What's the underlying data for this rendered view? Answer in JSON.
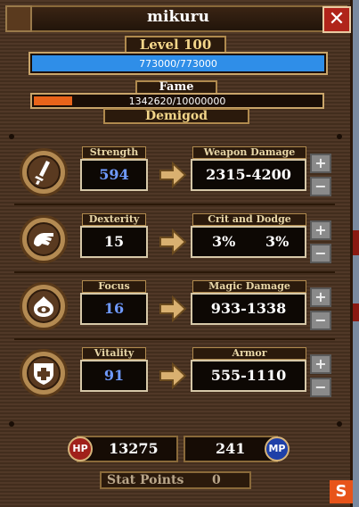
{
  "player": {
    "name": "mikuru"
  },
  "level": {
    "label": "Level 100"
  },
  "hp_bar": {
    "text": "773000/773000",
    "fraction": 1.0,
    "color": "#2f8ee8"
  },
  "fame": {
    "label": "Fame",
    "text": "1342620/10000000",
    "fraction": 0.134,
    "color": "#e8641a",
    "rank": "Demigod"
  },
  "stats": [
    {
      "key": "strength",
      "label": "Strength",
      "value": "594",
      "value_color": "#6f9aff",
      "derived_label": "Weapon Damage",
      "derived": [
        "2315-4200"
      ],
      "icon": "sword-icon"
    },
    {
      "key": "dexterity",
      "label": "Dexterity",
      "value": "15",
      "value_color": "#ffffff",
      "derived_label": "Crit and Dodge",
      "derived": [
        "3%",
        "3%"
      ],
      "icon": "hand-icon"
    },
    {
      "key": "focus",
      "label": "Focus",
      "value": "16",
      "value_color": "#6f9aff",
      "derived_label": "Magic Damage",
      "derived": [
        "933-1338"
      ],
      "icon": "eye-icon"
    },
    {
      "key": "vitality",
      "label": "Vitality",
      "value": "91",
      "value_color": "#6f9aff",
      "derived_label": "Armor",
      "derived": [
        "555-1110"
      ],
      "icon": "shield-icon"
    }
  ],
  "controls": {
    "plus": "+",
    "minus": "−",
    "close": "✕"
  },
  "footer": {
    "hp_label": "HP",
    "hp_value": "13275",
    "mp_label": "MP",
    "mp_value": "241",
    "stat_points_label": "Stat Points",
    "stat_points_value": "0"
  },
  "brand": {
    "glyph": "S"
  }
}
